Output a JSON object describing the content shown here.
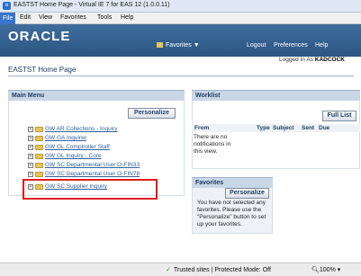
{
  "window": {
    "title": "EASTST Home Page - Virtual IE 7 for EAS 12 (1.0.0.11)"
  },
  "menubar": {
    "items": [
      "File",
      "Edit",
      "View",
      "Favorites",
      "Tools",
      "Help"
    ]
  },
  "header": {
    "logo": "ORACLE",
    "favorites_nav": "Favorites ▼",
    "links": [
      "Logout",
      "Preferences",
      "Help"
    ]
  },
  "user": {
    "logged_in_prefix": "Logged In As",
    "username": "KADCOCK"
  },
  "page": {
    "title": "EASTST Home Page"
  },
  "main_menu": {
    "title": "Main Menu",
    "personalize_label": "Personalize",
    "items": [
      "GW AR Collections - Inquiry",
      "GW GA Inquirer",
      "GW GL Comptroller Staff",
      "GW GL Inquiry - Core",
      "GW SC Departmental User O-FIN33",
      "GW SC Departmental User O-FIN78",
      "GW SC Supplier Inquiry"
    ]
  },
  "worklist": {
    "title": "Worklist",
    "full_list_label": "Full List",
    "columns": [
      "From",
      "Type",
      "Subject",
      "Sent",
      "Due"
    ],
    "empty_message": "There are no notifications in this view."
  },
  "favorites": {
    "title": "Favorites",
    "personalize_label": "Personalize",
    "message": "You have not selected any favorites. Please use the \"Personalize\" button to set up your favorites."
  },
  "status": {
    "security": "Trusted sites | Protected Mode: Off",
    "zoom": "100%"
  },
  "colors": {
    "header": "#2b5683",
    "highlight": "#e01b1b",
    "link": "#2f5f9a"
  }
}
